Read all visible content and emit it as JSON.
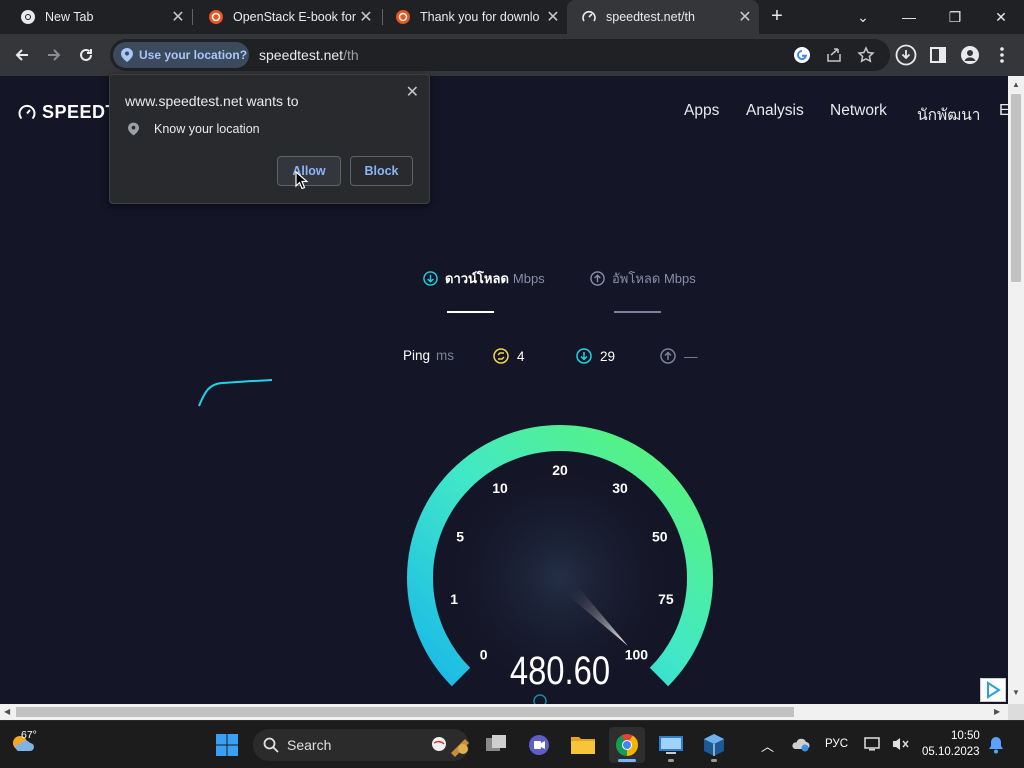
{
  "browser": {
    "tabs": [
      {
        "title": "New Tab",
        "active": false
      },
      {
        "title": "OpenStack E-book for",
        "active": false
      },
      {
        "title": "Thank you for downlo",
        "active": false
      },
      {
        "title": "speedtest.net/th",
        "active": true
      }
    ],
    "new_tab_label": "+",
    "close_glyph": "✕",
    "window_controls": {
      "dropdown": "⌄",
      "minimize": "—",
      "restore": "❐",
      "close": "✕"
    },
    "location_chip": "Use your location?",
    "url_host": "speedtest.net",
    "url_path": "/th"
  },
  "permission_popup": {
    "title": "www.speedtest.net wants to",
    "close": "✕",
    "permission": "Know your location",
    "allow": "Allow",
    "block": "Block"
  },
  "site": {
    "logo_text": "SPEEDT",
    "nav": [
      "Apps",
      "Analysis",
      "Network",
      "นักพัฒนา",
      "E"
    ],
    "download_label": "ดาวน์โหลด",
    "download_unit": "Mbps",
    "upload_label": "อัพโหลด Mbps",
    "ping_label": "Ping",
    "ping_unit": "ms",
    "ping_value": "4",
    "ping_down": "29",
    "ping_up": "—",
    "gauge": {
      "ticks": [
        "0",
        "1",
        "5",
        "10",
        "20",
        "30",
        "50",
        "75",
        "100"
      ],
      "reading": "480.60",
      "needle_fraction": 1.0
    },
    "colors": {
      "background": "#141526",
      "accent_cyan": "#1cd5e6",
      "accent_green": "#4cf08a",
      "ping_yellow": "#f2d84a"
    }
  },
  "taskbar": {
    "weather_temp": "67°",
    "search_placeholder": "Search",
    "language": "РУС",
    "time": "10:50",
    "date": "05.10.2023"
  }
}
